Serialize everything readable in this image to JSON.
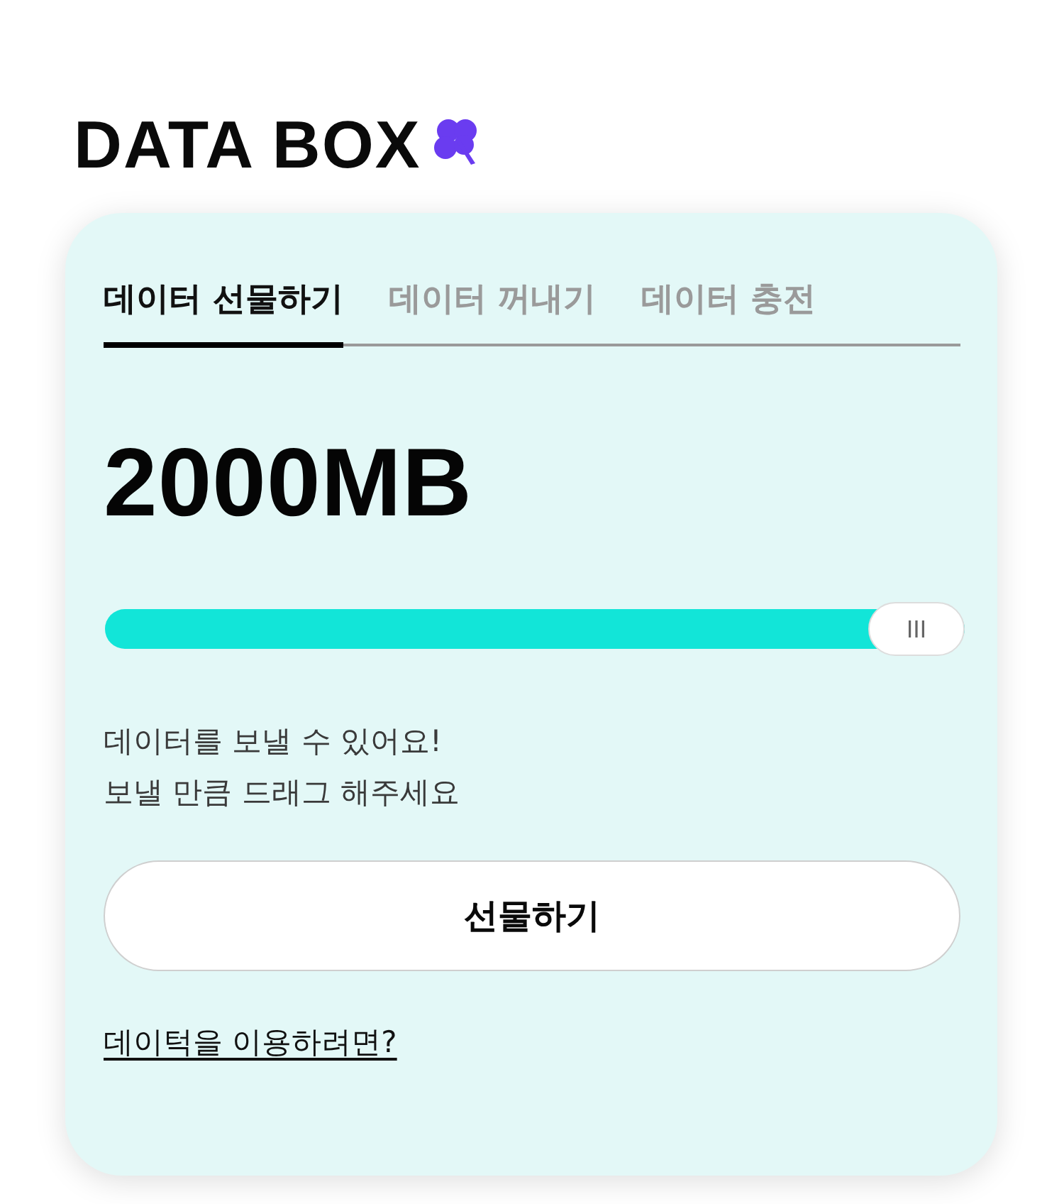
{
  "logo": {
    "text": "DATA BOX"
  },
  "tabs": [
    {
      "label": "데이터 선물하기",
      "selected": true
    },
    {
      "label": "데이터 꺼내기",
      "selected": false
    },
    {
      "label": "데이터 충전",
      "selected": false
    }
  ],
  "amount": "2000MB",
  "slider": {
    "level": 1
  },
  "message": [
    "데이터를 보낼 수 있어요!",
    "보낼 만큼 드래그 해주세요"
  ],
  "primary_button": "선물하기",
  "help_link": "데이턱을 이용하려면?"
}
